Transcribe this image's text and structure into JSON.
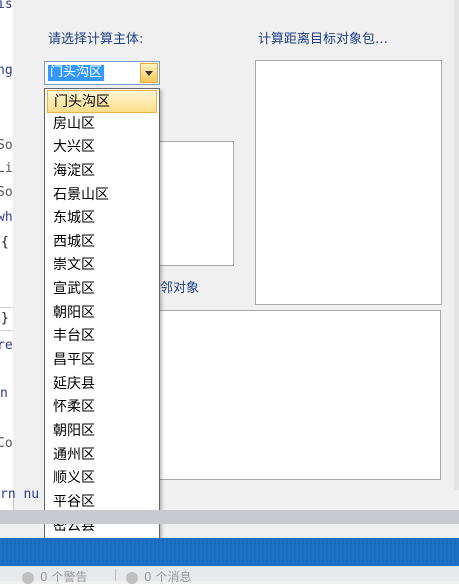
{
  "editor": {
    "fragments": [
      {
        "text": "is",
        "style": "blue"
      },
      {
        "text": "ng",
        "style": "blue"
      },
      {
        "text": "So",
        "style": "gray"
      },
      {
        "text": "Li",
        "style": "gray"
      },
      {
        "text": "So",
        "style": "gray"
      },
      {
        "text": "wh",
        "style": "blue"
      },
      {
        "text": "{",
        "style": "dark"
      },
      {
        "text": "}",
        "style": "dark"
      },
      {
        "text": "re",
        "style": "blue"
      },
      {
        "text": "n",
        "style": "blue"
      },
      {
        "text": "Co",
        "style": "gray"
      }
    ],
    "return_line": "rn nu"
  },
  "form": {
    "select_label": "请选择计算主体:",
    "target_label": "计算距离目标对象包…",
    "neighbor_label": "邻对象",
    "combo": {
      "value": "门头沟区"
    },
    "dropdown": {
      "options": [
        "门头沟区",
        "房山区",
        "大兴区",
        "海淀区",
        "石景山区",
        "东城区",
        "西城区",
        "崇文区",
        "宣武区",
        "朝阳区",
        "丰台区",
        "昌平区",
        "延庆县",
        "怀柔区",
        "朝阳区",
        "通州区",
        "顺义区",
        "平谷区",
        "密云县"
      ],
      "selected_index": 0
    }
  },
  "bottom_panel": {
    "warnings": "0 个警告",
    "messages": "0 个消息"
  },
  "colors": {
    "label": "#1f3d8a",
    "selection": "#3399ff",
    "statusbar": "#1e73c8"
  }
}
